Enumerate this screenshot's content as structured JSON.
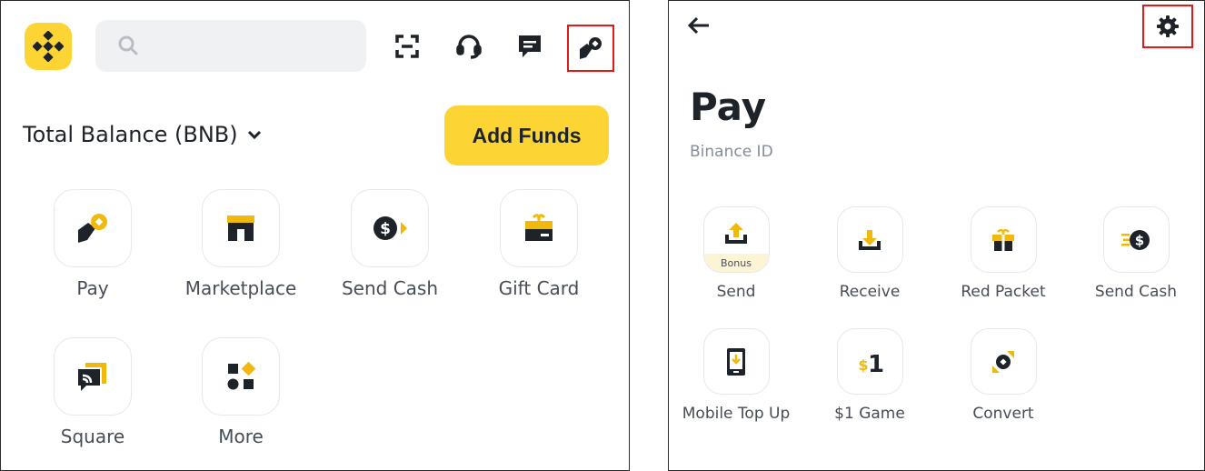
{
  "left": {
    "search": {
      "placeholder": ""
    },
    "header_icons": [
      "scan-icon",
      "headset-icon",
      "chat-icon",
      "pay-icon"
    ],
    "balance_label": "Total Balance (BNB)",
    "add_funds_label": "Add Funds",
    "tiles": [
      {
        "label": "Pay",
        "icon": "pay-icon"
      },
      {
        "label": "Marketplace",
        "icon": "store-icon"
      },
      {
        "label": "Send Cash",
        "icon": "send-cash-icon"
      },
      {
        "label": "Gift Card",
        "icon": "gift-card-icon"
      },
      {
        "label": "Square",
        "icon": "square-icon"
      },
      {
        "label": "More",
        "icon": "more-icon"
      }
    ]
  },
  "right": {
    "title": "Pay",
    "subtitle": "Binance ID",
    "tiles": [
      {
        "label": "Send",
        "badge": "Bonus",
        "icon": "send-icon"
      },
      {
        "label": "Receive",
        "icon": "receive-icon"
      },
      {
        "label": "Red Packet",
        "icon": "red-packet-icon"
      },
      {
        "label": "Send Cash",
        "icon": "send-cash-icon"
      },
      {
        "label": "Mobile Top Up",
        "icon": "mobile-topup-icon"
      },
      {
        "label": "$1 Game",
        "icon": "dollar-game-icon"
      },
      {
        "label": "Convert",
        "icon": "convert-icon"
      }
    ]
  },
  "colors": {
    "brand": "#fcd535",
    "text": "#1e2329",
    "muted": "#848e9c",
    "highlight": "#e0191b"
  }
}
